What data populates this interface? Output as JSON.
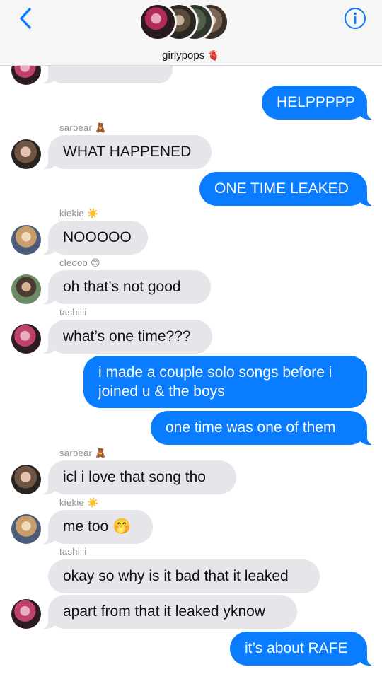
{
  "header": {
    "group_name": "girlypops",
    "group_emoji": "🫀",
    "back_icon": "chevron-left-icon",
    "info_icon": "info-icon"
  },
  "colors": {
    "accent": "#0a7cff",
    "incoming": "#e5e5ea"
  },
  "messages": {
    "m0": "HELPPPPP",
    "m1_sender": "sarbear 🧸",
    "m1": "WHAT HAPPENED",
    "m2": "ONE TIME LEAKED",
    "m3_sender": "kiekie ☀️",
    "m3": "NOOOOO",
    "m4_sender": "cleooo 😊",
    "m4": "oh that’s not good",
    "m5_sender": "tashiiii",
    "m5": "what’s one time???",
    "m6": "i made a couple solo songs before i joined u & the boys",
    "m7": "one time was one of them",
    "m8_sender": "sarbear 🧸",
    "m8": "icl i love that song tho",
    "m9_sender": "kiekie ☀️",
    "m9": "me too 🤭",
    "m10_sender": "tashiiii",
    "m10": "okay so why is it bad that it leaked",
    "m11": "apart from that it leaked yknow",
    "m12": "it’s about RAFE"
  }
}
